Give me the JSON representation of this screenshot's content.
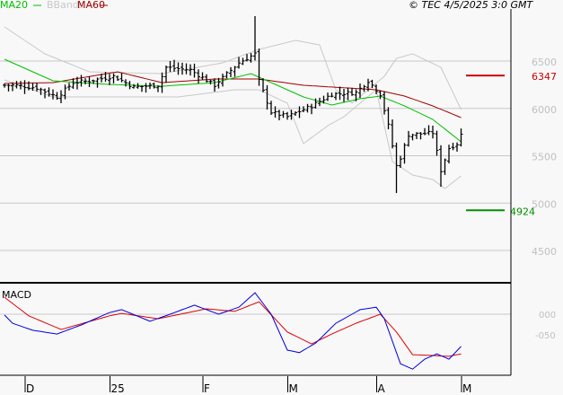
{
  "chart_data": {
    "type": "ohlc",
    "title": "",
    "copyright": "© TEC 4/5/2025 3:0 GMT",
    "legend": [
      {
        "name": "MA20",
        "color": "#00c000"
      },
      {
        "name": "BBands",
        "color": "#c8c8c8"
      },
      {
        "name": "MA60",
        "color": "#a00000"
      }
    ],
    "legend_position": "top-left",
    "price_axis": {
      "ticks": [
        6500,
        6000,
        5500,
        5000,
        4500
      ],
      "tick_labels": [
        "6500",
        "6000",
        "5500",
        "5000",
        "4500"
      ],
      "range": [
        4150,
        7150
      ],
      "grid": true
    },
    "x_axis": {
      "bar_count": 114,
      "ticks": [
        {
          "bar": 5,
          "label": "D"
        },
        {
          "bar": 26,
          "label": "25"
        },
        {
          "bar": 49,
          "label": "F"
        },
        {
          "bar": 70,
          "label": "M"
        },
        {
          "bar": 92,
          "label": "A"
        },
        {
          "bar": 113,
          "label": "M"
        }
      ]
    },
    "markers": [
      {
        "value": 6347,
        "label": "6347",
        "color": "#cc0000"
      },
      {
        "value": 4924,
        "label": "4924",
        "color": "#009000"
      }
    ],
    "close_keypoints": [
      [
        0,
        6244
      ],
      [
        3,
        6244
      ],
      [
        8,
        6216
      ],
      [
        13,
        6121
      ],
      [
        17,
        6273
      ],
      [
        21,
        6291
      ],
      [
        27,
        6339
      ],
      [
        32,
        6225
      ],
      [
        38,
        6244
      ],
      [
        40,
        6434
      ],
      [
        46,
        6405
      ],
      [
        52,
        6244
      ],
      [
        58,
        6481
      ],
      [
        62,
        6576
      ],
      [
        63,
        6290
      ],
      [
        66,
        5960
      ],
      [
        70,
        5912
      ],
      [
        76,
        6026
      ],
      [
        81,
        6149
      ],
      [
        87,
        6168
      ],
      [
        90,
        6291
      ],
      [
        93,
        6149
      ],
      [
        95,
        5818
      ],
      [
        97,
        5391
      ],
      [
        98,
        5480
      ],
      [
        100,
        5722
      ],
      [
        106,
        5742
      ],
      [
        108,
        5344
      ],
      [
        110,
        5580
      ],
      [
        112,
        5627
      ],
      [
        113,
        5722
      ]
    ],
    "extremes": [
      {
        "bar": 62,
        "high": 6974
      },
      {
        "bar": 97,
        "low": 5107
      },
      {
        "bar": 108,
        "low": 5173
      }
    ],
    "ma20": [
      [
        0,
        6519
      ],
      [
        12,
        6291
      ],
      [
        26,
        6253
      ],
      [
        39,
        6234
      ],
      [
        52,
        6272
      ],
      [
        61,
        6367
      ],
      [
        66,
        6272
      ],
      [
        74,
        6121
      ],
      [
        81,
        6036
      ],
      [
        88,
        6102
      ],
      [
        93,
        6130
      ],
      [
        99,
        6026
      ],
      [
        106,
        5884
      ],
      [
        113,
        5647
      ]
    ],
    "ma60": [
      [
        0,
        6263
      ],
      [
        12,
        6272
      ],
      [
        28,
        6386
      ],
      [
        39,
        6272
      ],
      [
        52,
        6310
      ],
      [
        63,
        6310
      ],
      [
        74,
        6244
      ],
      [
        92,
        6197
      ],
      [
        99,
        6130
      ],
      [
        106,
        6026
      ],
      [
        113,
        5903
      ]
    ],
    "bb_upper": [
      [
        0,
        6860
      ],
      [
        10,
        6576
      ],
      [
        21,
        6386
      ],
      [
        39,
        6367
      ],
      [
        54,
        6481
      ],
      [
        63,
        6623
      ],
      [
        72,
        6718
      ],
      [
        78,
        6670
      ],
      [
        82,
        6197
      ],
      [
        86,
        6055
      ],
      [
        94,
        6339
      ],
      [
        97,
        6528
      ],
      [
        101,
        6576
      ],
      [
        108,
        6434
      ],
      [
        113,
        5988
      ]
    ],
    "bb_lower": [
      [
        0,
        6301
      ],
      [
        12,
        6121
      ],
      [
        26,
        6121
      ],
      [
        43,
        6121
      ],
      [
        57,
        6197
      ],
      [
        63,
        6197
      ],
      [
        70,
        6055
      ],
      [
        74,
        5628
      ],
      [
        80,
        5817
      ],
      [
        84,
        5912
      ],
      [
        92,
        6197
      ],
      [
        96,
        5438
      ],
      [
        101,
        5296
      ],
      [
        106,
        5249
      ],
      [
        109,
        5154
      ],
      [
        113,
        5287
      ]
    ],
    "macd": {
      "title": "MACD",
      "ticks": [
        0,
        -0.5
      ],
      "tick_labels": [
        "000",
        "-050"
      ],
      "range": [
        -1.5,
        0.75
      ],
      "macd_line": {
        "color": "#0000e0",
        "points": [
          [
            0,
            -0.02
          ],
          [
            2,
            -0.22
          ],
          [
            7,
            -0.39
          ],
          [
            13,
            -0.48
          ],
          [
            19,
            -0.26
          ],
          [
            26,
            0.04
          ],
          [
            29,
            0.11
          ],
          [
            36,
            -0.17
          ],
          [
            41,
            0
          ],
          [
            47,
            0.22
          ],
          [
            53,
            0
          ],
          [
            58,
            0.17
          ],
          [
            62,
            0.52
          ],
          [
            66,
            0
          ],
          [
            70,
            -0.87
          ],
          [
            73,
            -0.93
          ],
          [
            77,
            -0.7
          ],
          [
            82,
            -0.22
          ],
          [
            88,
            0.11
          ],
          [
            92,
            0.17
          ],
          [
            94,
            -0.11
          ],
          [
            98,
            -1.2
          ],
          [
            101,
            -1.33
          ],
          [
            104,
            -1.09
          ],
          [
            107,
            -0.96
          ],
          [
            110,
            -1.09
          ],
          [
            113,
            -0.78
          ]
        ]
      },
      "signal_line": {
        "color": "#e00000",
        "points": [
          [
            0,
            0.41
          ],
          [
            6,
            -0.04
          ],
          [
            14,
            -0.37
          ],
          [
            26,
            -0.04
          ],
          [
            29,
            0.02
          ],
          [
            38,
            -0.11
          ],
          [
            50,
            0.13
          ],
          [
            57,
            0.07
          ],
          [
            63,
            0.3
          ],
          [
            70,
            -0.43
          ],
          [
            76,
            -0.72
          ],
          [
            81,
            -0.48
          ],
          [
            87,
            -0.22
          ],
          [
            93,
            0
          ],
          [
            97,
            -0.43
          ],
          [
            101,
            -0.98
          ],
          [
            106,
            -1.0
          ],
          [
            110,
            -1.02
          ],
          [
            113,
            -0.96
          ]
        ]
      }
    }
  }
}
